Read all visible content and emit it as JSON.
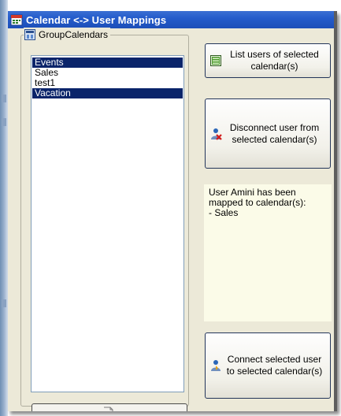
{
  "window": {
    "title": "Calendar <-> User Mappings",
    "icon": "calendar-app-icon"
  },
  "group": {
    "label": "GroupCalendars",
    "icon": "group-calendar-icon"
  },
  "calendars": [
    {
      "name": "Events",
      "selected": true
    },
    {
      "name": "Sales",
      "selected": false
    },
    {
      "name": "test1",
      "selected": false
    },
    {
      "name": "Vacation",
      "selected": true
    }
  ],
  "buttons": {
    "list_users": {
      "label": "List users of selected\ncalendar(s)",
      "icon": "list-users-icon"
    },
    "disconnect": {
      "label": "Disconnect user from\nselected calendar(s)",
      "icon": "disconnect-user-icon"
    },
    "connect": {
      "label": "Connect selected user\nto selected calendar(s)",
      "icon": "connect-user-icon"
    }
  },
  "status": {
    "lines": [
      "User Amini has been",
      "mapped to calendar(s):",
      "- Sales"
    ]
  },
  "colors": {
    "titlebar": "#245ccb",
    "selection": "#0a246a",
    "dialog_background": "#ece9d8",
    "info_background": "#fbfbe8"
  }
}
